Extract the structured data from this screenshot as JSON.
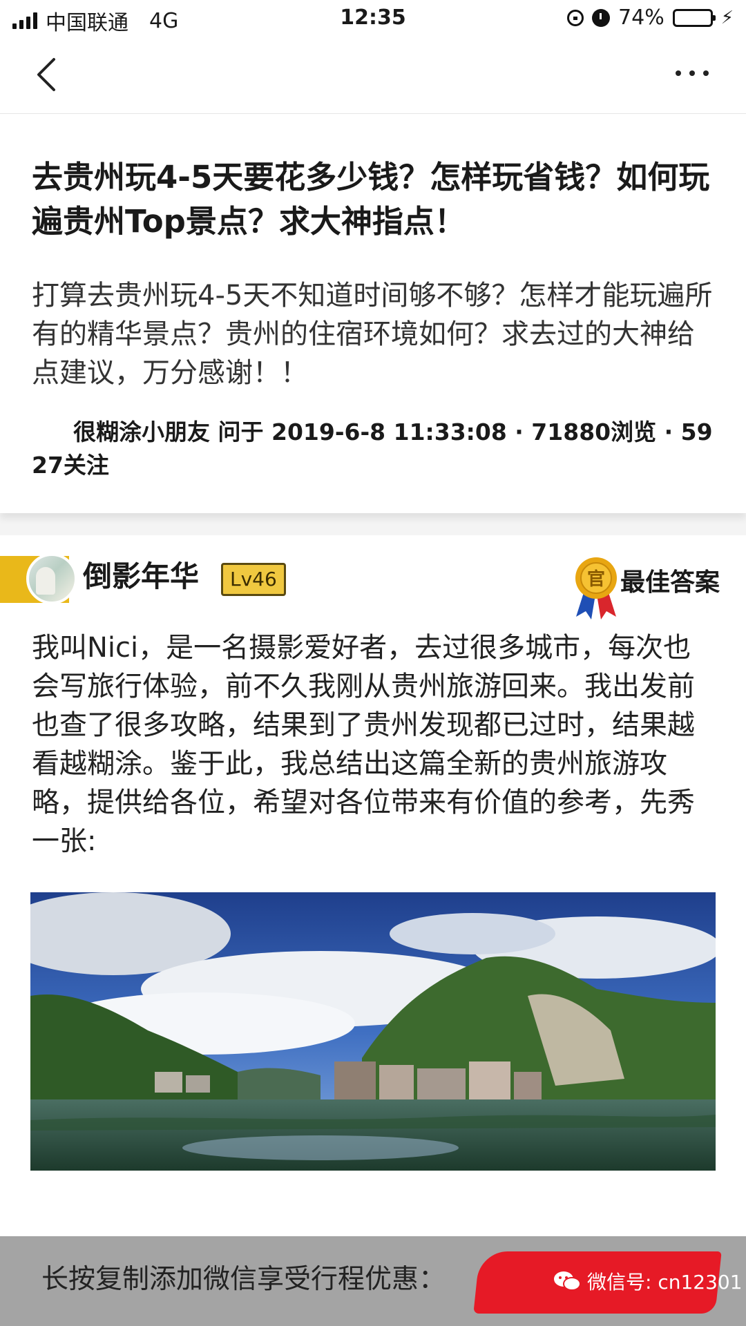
{
  "status_bar": {
    "carrier": "中国联通",
    "network": "4G",
    "time": "12:35",
    "battery": "74%",
    "battery_level": 0.74
  },
  "nav": {
    "back_icon": "chevron-left-icon",
    "more_icon": "more-dots-icon"
  },
  "question": {
    "title": "去贵州玩4-5天要花多少钱？怎样玩省钱？如何玩遍贵州Top景点？求大神指点！",
    "description": "打算去贵州玩4-5天不知道时间够不够？怎样才能玩遍所有的精华景点？贵州的住宿环境如何？求去过的大神给点建议，万分感谢！！",
    "meta": "很糊涂小朋友 问于 2019-6-8 11:33:08 · 71880浏览 · 5927关注"
  },
  "answer": {
    "author": "倒影年华",
    "level": "Lv46",
    "medal_text": "官",
    "best_label": "最佳答案",
    "body": "我叫Nici，是一名摄影爱好者，去过很多城市，每次也会写旅行体验，前不久我刚从贵州旅游回来。我出发前也查了很多攻略，结果到了贵州发现都已过时，结果越看越糊涂。鉴于此，我总结出这篇全新的贵州旅游攻略，提供给各位，希望对各位带来有价值的参考，先秀一张:"
  },
  "bottom": {
    "promo": "长按复制添加微信享受行程优惠：",
    "watermark": "微信号: cn12301"
  },
  "colors": {
    "accent_gold": "#e9b81a",
    "battery_green": "#3fc54a",
    "redact_red": "#e61a26"
  }
}
